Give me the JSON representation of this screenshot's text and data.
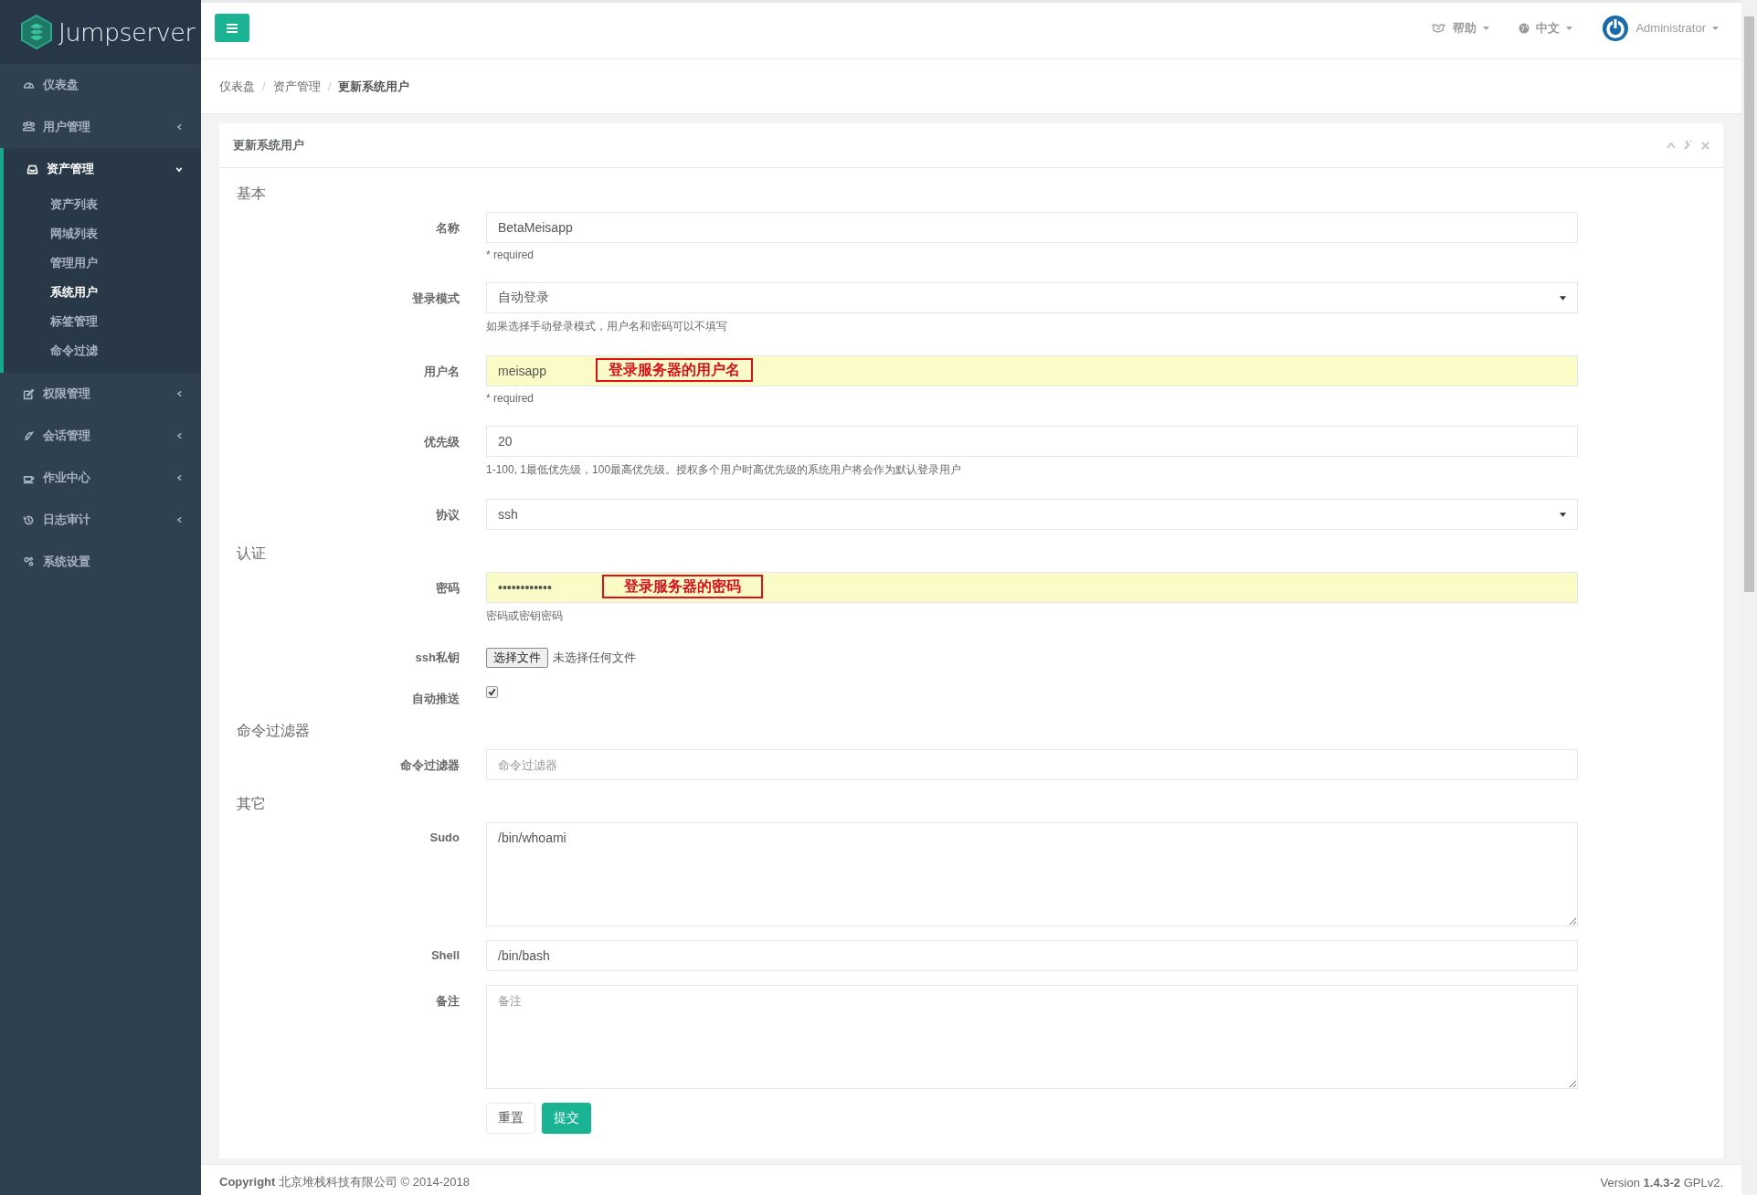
{
  "brand": {
    "name": "Jumpserver"
  },
  "sidebar": {
    "items": [
      {
        "label": "仪表盘",
        "selected": false
      },
      {
        "label": "用户管理",
        "selected": false,
        "expanded": false
      },
      {
        "label": "资产管理",
        "selected": true,
        "expanded": true,
        "children": [
          {
            "label": "资产列表",
            "selected": false
          },
          {
            "label": "网域列表",
            "selected": false
          },
          {
            "label": "管理用户",
            "selected": false
          },
          {
            "label": "系统用户",
            "selected": true
          },
          {
            "label": "标签管理",
            "selected": false
          },
          {
            "label": "命令过滤",
            "selected": false
          }
        ]
      },
      {
        "label": "权限管理",
        "selected": false,
        "expanded": false
      },
      {
        "label": "会话管理",
        "selected": false,
        "expanded": false
      },
      {
        "label": "作业中心",
        "selected": false,
        "expanded": false
      },
      {
        "label": "日志审计",
        "selected": false,
        "expanded": false
      },
      {
        "label": "系统设置",
        "selected": false
      }
    ]
  },
  "topbar": {
    "menus": [
      {
        "label": "帮助"
      },
      {
        "label": "中文"
      },
      {
        "label": "Administrator"
      }
    ]
  },
  "breadcrumb": {
    "separator": "/",
    "items": [
      "仪表盘",
      "资产管理",
      "更新系统用户"
    ]
  },
  "panel": {
    "title": "更新系统用户",
    "sections": [
      {
        "title": "基本",
        "fields": [
          {
            "kind": "text",
            "label": "名称",
            "value": "BetaMeisapp",
            "help": "* required",
            "highlighted": false
          },
          {
            "kind": "select",
            "label": "登录模式",
            "value": "自动登录",
            "help": "如果选择手动登录模式，用户名和密码可以不填写"
          },
          {
            "kind": "text",
            "label": "用户名",
            "value": "meisapp",
            "help": "* required",
            "highlighted": true,
            "annotation": "登录服务器的用户名"
          },
          {
            "kind": "text",
            "label": "优先级",
            "value": "20",
            "help": "1-100, 1最低优先级，100最高优先级。授权多个用户时高优先级的系统用户将会作为默认登录用户",
            "highlighted": false
          },
          {
            "kind": "select",
            "label": "协议",
            "value": "ssh"
          }
        ]
      },
      {
        "title": "认证",
        "fields": [
          {
            "kind": "text",
            "label": "密码",
            "value": "••••••••••••",
            "help": "密码或密钥密码",
            "highlighted": true,
            "annotation": "登录服务器的密码"
          },
          {
            "kind": "file",
            "label": "ssh私钥",
            "button": "选择文件",
            "status": "未选择任何文件"
          },
          {
            "kind": "checkbox",
            "label": "自动推送",
            "checked": true
          }
        ]
      },
      {
        "title": "命令过滤器",
        "fields": [
          {
            "kind": "text",
            "label": "命令过滤器",
            "placeholder": "命令过滤器",
            "highlighted": false
          }
        ]
      },
      {
        "title": "其它",
        "fields": [
          {
            "kind": "textarea",
            "label": "Sudo",
            "value": "/bin/whoami"
          },
          {
            "kind": "text",
            "label": "Shell",
            "value": "/bin/bash",
            "highlighted": false
          },
          {
            "kind": "textarea",
            "label": "备注",
            "placeholder": "备注"
          }
        ]
      }
    ],
    "buttons": [
      {
        "label": "重置",
        "kind": "default"
      },
      {
        "label": "提交",
        "kind": "primary"
      }
    ]
  },
  "footer": {
    "copyright": "**Copyright** 北京堆栈科技有限公司 © 2014-2018",
    "version": "Version **1.4.3-2** GPLv2."
  }
}
